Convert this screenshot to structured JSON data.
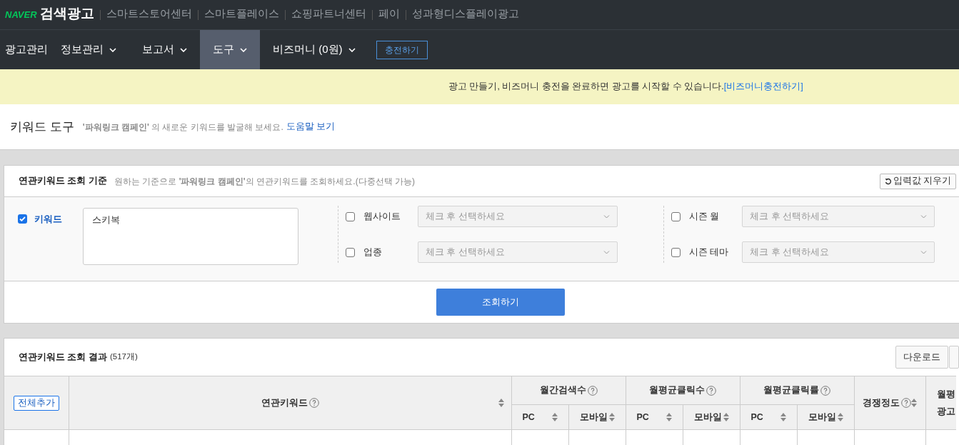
{
  "top_bar": {
    "brand": "NAVER",
    "product": "검색광고",
    "links": [
      "스마트스토어센터",
      "스마트플레이스",
      "쇼핑파트너센터",
      "페이",
      "성과형디스플레이광고"
    ]
  },
  "nav": {
    "items": [
      {
        "label": "광고관리",
        "dropdown": false,
        "selected": false
      },
      {
        "label": "정보관리",
        "dropdown": true,
        "selected": false
      },
      {
        "label": "보고서",
        "dropdown": true,
        "selected": false
      },
      {
        "label": "도구",
        "dropdown": true,
        "selected": true
      },
      {
        "label": "비즈머니 (0원)",
        "dropdown": true,
        "selected": false
      }
    ],
    "charge_button": "충전하기"
  },
  "notice": {
    "text": "광고 만들기, 비즈머니 충전을 완료하면 광고를 시작할 수 있습니다.",
    "link": "[비즈머니충전하기]"
  },
  "page_header": {
    "title": "키워드 도구",
    "description": "**'파워링크 캠페인'** 의 새로운 키워드를 발굴해 보세요.",
    "help_link": "도움말 보기"
  },
  "criteria": {
    "title": "연관키워드 조회 기준",
    "hint": "원하는 기준으로 **'파워링크 캠페인'**의 연관키워드를 조회하세요.(다중선택 가능)",
    "reset_button": "입력값 지우기",
    "keyword": {
      "label": "키워드",
      "checked": true,
      "value": "스키복"
    },
    "filters": [
      [
        {
          "label": "웹사이트",
          "checked": false,
          "placeholder": "체크 후 선택하세요"
        },
        {
          "label": "업종",
          "checked": false,
          "placeholder": "체크 후 선택하세요"
        }
      ],
      [
        {
          "label": "시즌 월",
          "checked": false,
          "placeholder": "체크 후 선택하세요"
        },
        {
          "label": "시즌 테마",
          "checked": false,
          "placeholder": "체크 후 선택하세요"
        }
      ]
    ],
    "search_button": "조회하기"
  },
  "results": {
    "title": "연관키워드 조회 결과",
    "count": "(517개)",
    "download_button": "다운로드",
    "add_all_button": "전체추가",
    "table": {
      "keyword_column": "연관키워드",
      "groups": [
        {
          "label": "월간검색수",
          "sub": [
            "PC",
            "모바일"
          ]
        },
        {
          "label": "월평균클릭수",
          "sub": [
            "PC",
            "모바일"
          ]
        },
        {
          "label": "월평균클릭률",
          "sub": [
            "PC",
            "모바일"
          ]
        }
      ],
      "competition_column": "경쟁정도",
      "column_last": [
        "월평",
        "광고"
      ]
    }
  }
}
